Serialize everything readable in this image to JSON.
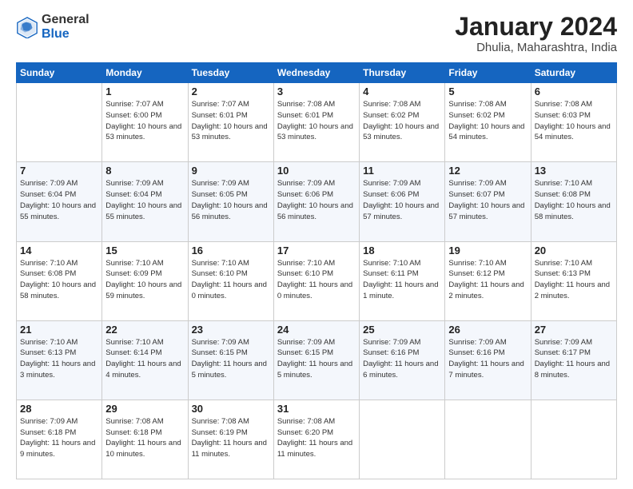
{
  "logo": {
    "general": "General",
    "blue": "Blue"
  },
  "header": {
    "title": "January 2024",
    "subtitle": "Dhulia, Maharashtra, India"
  },
  "weekdays": [
    "Sunday",
    "Monday",
    "Tuesday",
    "Wednesday",
    "Thursday",
    "Friday",
    "Saturday"
  ],
  "weeks": [
    [
      {
        "day": "",
        "sunrise": "",
        "sunset": "",
        "daylight": ""
      },
      {
        "day": "1",
        "sunrise": "Sunrise: 7:07 AM",
        "sunset": "Sunset: 6:00 PM",
        "daylight": "Daylight: 10 hours and 53 minutes."
      },
      {
        "day": "2",
        "sunrise": "Sunrise: 7:07 AM",
        "sunset": "Sunset: 6:01 PM",
        "daylight": "Daylight: 10 hours and 53 minutes."
      },
      {
        "day": "3",
        "sunrise": "Sunrise: 7:08 AM",
        "sunset": "Sunset: 6:01 PM",
        "daylight": "Daylight: 10 hours and 53 minutes."
      },
      {
        "day": "4",
        "sunrise": "Sunrise: 7:08 AM",
        "sunset": "Sunset: 6:02 PM",
        "daylight": "Daylight: 10 hours and 53 minutes."
      },
      {
        "day": "5",
        "sunrise": "Sunrise: 7:08 AM",
        "sunset": "Sunset: 6:02 PM",
        "daylight": "Daylight: 10 hours and 54 minutes."
      },
      {
        "day": "6",
        "sunrise": "Sunrise: 7:08 AM",
        "sunset": "Sunset: 6:03 PM",
        "daylight": "Daylight: 10 hours and 54 minutes."
      }
    ],
    [
      {
        "day": "7",
        "sunrise": "Sunrise: 7:09 AM",
        "sunset": "Sunset: 6:04 PM",
        "daylight": "Daylight: 10 hours and 55 minutes."
      },
      {
        "day": "8",
        "sunrise": "Sunrise: 7:09 AM",
        "sunset": "Sunset: 6:04 PM",
        "daylight": "Daylight: 10 hours and 55 minutes."
      },
      {
        "day": "9",
        "sunrise": "Sunrise: 7:09 AM",
        "sunset": "Sunset: 6:05 PM",
        "daylight": "Daylight: 10 hours and 56 minutes."
      },
      {
        "day": "10",
        "sunrise": "Sunrise: 7:09 AM",
        "sunset": "Sunset: 6:06 PM",
        "daylight": "Daylight: 10 hours and 56 minutes."
      },
      {
        "day": "11",
        "sunrise": "Sunrise: 7:09 AM",
        "sunset": "Sunset: 6:06 PM",
        "daylight": "Daylight: 10 hours and 57 minutes."
      },
      {
        "day": "12",
        "sunrise": "Sunrise: 7:09 AM",
        "sunset": "Sunset: 6:07 PM",
        "daylight": "Daylight: 10 hours and 57 minutes."
      },
      {
        "day": "13",
        "sunrise": "Sunrise: 7:10 AM",
        "sunset": "Sunset: 6:08 PM",
        "daylight": "Daylight: 10 hours and 58 minutes."
      }
    ],
    [
      {
        "day": "14",
        "sunrise": "Sunrise: 7:10 AM",
        "sunset": "Sunset: 6:08 PM",
        "daylight": "Daylight: 10 hours and 58 minutes."
      },
      {
        "day": "15",
        "sunrise": "Sunrise: 7:10 AM",
        "sunset": "Sunset: 6:09 PM",
        "daylight": "Daylight: 10 hours and 59 minutes."
      },
      {
        "day": "16",
        "sunrise": "Sunrise: 7:10 AM",
        "sunset": "Sunset: 6:10 PM",
        "daylight": "Daylight: 11 hours and 0 minutes."
      },
      {
        "day": "17",
        "sunrise": "Sunrise: 7:10 AM",
        "sunset": "Sunset: 6:10 PM",
        "daylight": "Daylight: 11 hours and 0 minutes."
      },
      {
        "day": "18",
        "sunrise": "Sunrise: 7:10 AM",
        "sunset": "Sunset: 6:11 PM",
        "daylight": "Daylight: 11 hours and 1 minute."
      },
      {
        "day": "19",
        "sunrise": "Sunrise: 7:10 AM",
        "sunset": "Sunset: 6:12 PM",
        "daylight": "Daylight: 11 hours and 2 minutes."
      },
      {
        "day": "20",
        "sunrise": "Sunrise: 7:10 AM",
        "sunset": "Sunset: 6:13 PM",
        "daylight": "Daylight: 11 hours and 2 minutes."
      }
    ],
    [
      {
        "day": "21",
        "sunrise": "Sunrise: 7:10 AM",
        "sunset": "Sunset: 6:13 PM",
        "daylight": "Daylight: 11 hours and 3 minutes."
      },
      {
        "day": "22",
        "sunrise": "Sunrise: 7:10 AM",
        "sunset": "Sunset: 6:14 PM",
        "daylight": "Daylight: 11 hours and 4 minutes."
      },
      {
        "day": "23",
        "sunrise": "Sunrise: 7:09 AM",
        "sunset": "Sunset: 6:15 PM",
        "daylight": "Daylight: 11 hours and 5 minutes."
      },
      {
        "day": "24",
        "sunrise": "Sunrise: 7:09 AM",
        "sunset": "Sunset: 6:15 PM",
        "daylight": "Daylight: 11 hours and 5 minutes."
      },
      {
        "day": "25",
        "sunrise": "Sunrise: 7:09 AM",
        "sunset": "Sunset: 6:16 PM",
        "daylight": "Daylight: 11 hours and 6 minutes."
      },
      {
        "day": "26",
        "sunrise": "Sunrise: 7:09 AM",
        "sunset": "Sunset: 6:16 PM",
        "daylight": "Daylight: 11 hours and 7 minutes."
      },
      {
        "day": "27",
        "sunrise": "Sunrise: 7:09 AM",
        "sunset": "Sunset: 6:17 PM",
        "daylight": "Daylight: 11 hours and 8 minutes."
      }
    ],
    [
      {
        "day": "28",
        "sunrise": "Sunrise: 7:09 AM",
        "sunset": "Sunset: 6:18 PM",
        "daylight": "Daylight: 11 hours and 9 minutes."
      },
      {
        "day": "29",
        "sunrise": "Sunrise: 7:08 AM",
        "sunset": "Sunset: 6:18 PM",
        "daylight": "Daylight: 11 hours and 10 minutes."
      },
      {
        "day": "30",
        "sunrise": "Sunrise: 7:08 AM",
        "sunset": "Sunset: 6:19 PM",
        "daylight": "Daylight: 11 hours and 11 minutes."
      },
      {
        "day": "31",
        "sunrise": "Sunrise: 7:08 AM",
        "sunset": "Sunset: 6:20 PM",
        "daylight": "Daylight: 11 hours and 11 minutes."
      },
      {
        "day": "",
        "sunrise": "",
        "sunset": "",
        "daylight": ""
      },
      {
        "day": "",
        "sunrise": "",
        "sunset": "",
        "daylight": ""
      },
      {
        "day": "",
        "sunrise": "",
        "sunset": "",
        "daylight": ""
      }
    ]
  ]
}
